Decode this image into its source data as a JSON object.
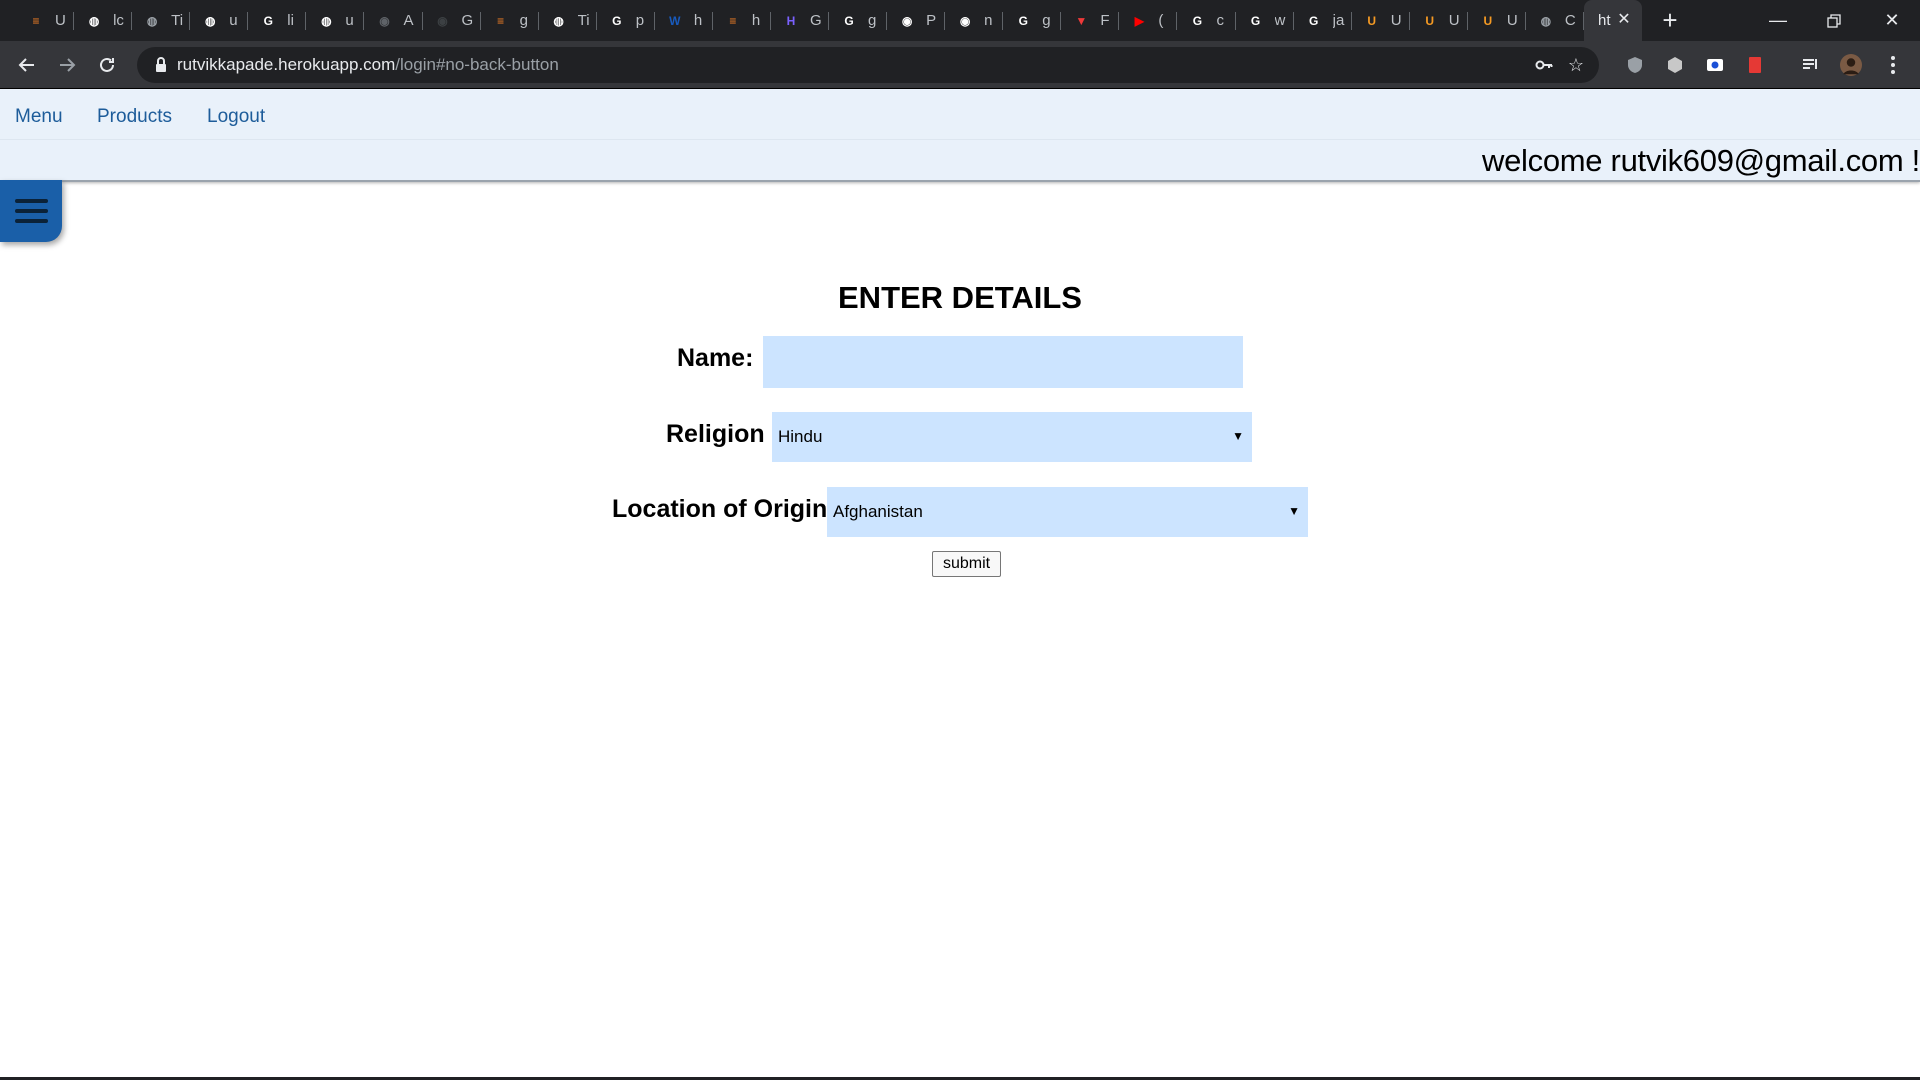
{
  "browser": {
    "tabs": [
      {
        "icon": "stackoverflow-icon",
        "text": "U",
        "color": "#f48024"
      },
      {
        "icon": "globe-icon",
        "text": "lc",
        "color": "#ffffff"
      },
      {
        "icon": "globe-icon",
        "text": "Ti",
        "color": "#9aa0a6"
      },
      {
        "icon": "globe-icon",
        "text": "u",
        "color": "#ffffff"
      },
      {
        "icon": "google-icon",
        "text": "li",
        "color": "#ffffff"
      },
      {
        "icon": "globe-icon",
        "text": "u",
        "color": "#ffffff"
      },
      {
        "icon": "github-icon",
        "text": "A",
        "color": "#5f6368"
      },
      {
        "icon": "github-icon",
        "text": "G",
        "color": "#3c4043"
      },
      {
        "icon": "stackoverflow-icon",
        "text": "g",
        "color": "#f48024"
      },
      {
        "icon": "globe-icon",
        "text": "Ti",
        "color": "#ffffff"
      },
      {
        "icon": "google-icon",
        "text": "p",
        "color": "#ffffff"
      },
      {
        "icon": "word-icon",
        "text": "h",
        "color": "#185abd"
      },
      {
        "icon": "stackoverflow-icon",
        "text": "h",
        "color": "#f48024"
      },
      {
        "icon": "hackerrank-icon",
        "text": "G",
        "color": "#7b61ff"
      },
      {
        "icon": "google-icon",
        "text": "g",
        "color": "#ffffff"
      },
      {
        "icon": "github-icon",
        "text": "P",
        "color": "#ffffff"
      },
      {
        "icon": "github-icon",
        "text": "n",
        "color": "#ffffff"
      },
      {
        "icon": "google-icon",
        "text": "g",
        "color": "#ffffff"
      },
      {
        "icon": "vivaldi-icon",
        "text": "F",
        "color": "#ef3939"
      },
      {
        "icon": "youtube-icon",
        "text": "(",
        "color": "#ff0000"
      },
      {
        "icon": "google-icon",
        "text": "c",
        "color": "#ffffff"
      },
      {
        "icon": "google-icon",
        "text": "w",
        "color": "#ffffff"
      },
      {
        "icon": "google-icon",
        "text": "ja",
        "color": "#ffffff"
      },
      {
        "icon": "udemy-icon",
        "text": "U",
        "color": "#f59a23"
      },
      {
        "icon": "udemy-icon",
        "text": "U",
        "color": "#f59a23"
      },
      {
        "icon": "udemy-icon",
        "text": "U",
        "color": "#f59a23"
      },
      {
        "icon": "globe-icon",
        "text": "C",
        "color": "#9aa0a6"
      }
    ],
    "active_tab_text": "ht",
    "url_host": "rutvikkapade.herokuapp.com",
    "url_path": "/login#no-back-button"
  },
  "nav": {
    "menu": "Menu",
    "products": "Products",
    "logout": "Logout",
    "welcome": "welcome  rutvik609@gmail.com !"
  },
  "form": {
    "title": "ENTER DETAILS",
    "name_label": "Name:",
    "name_value": "",
    "religion_label": "Religion",
    "religion_value": "Hindu",
    "location_label": "Location of Origin",
    "location_value": "Afghanistan",
    "submit_label": "submit"
  },
  "colors": {
    "nav_bg": "#e9f1fa",
    "link": "#1d5c9a",
    "field_bg": "#cce4ff",
    "hamburger": "#1a5fa8"
  }
}
